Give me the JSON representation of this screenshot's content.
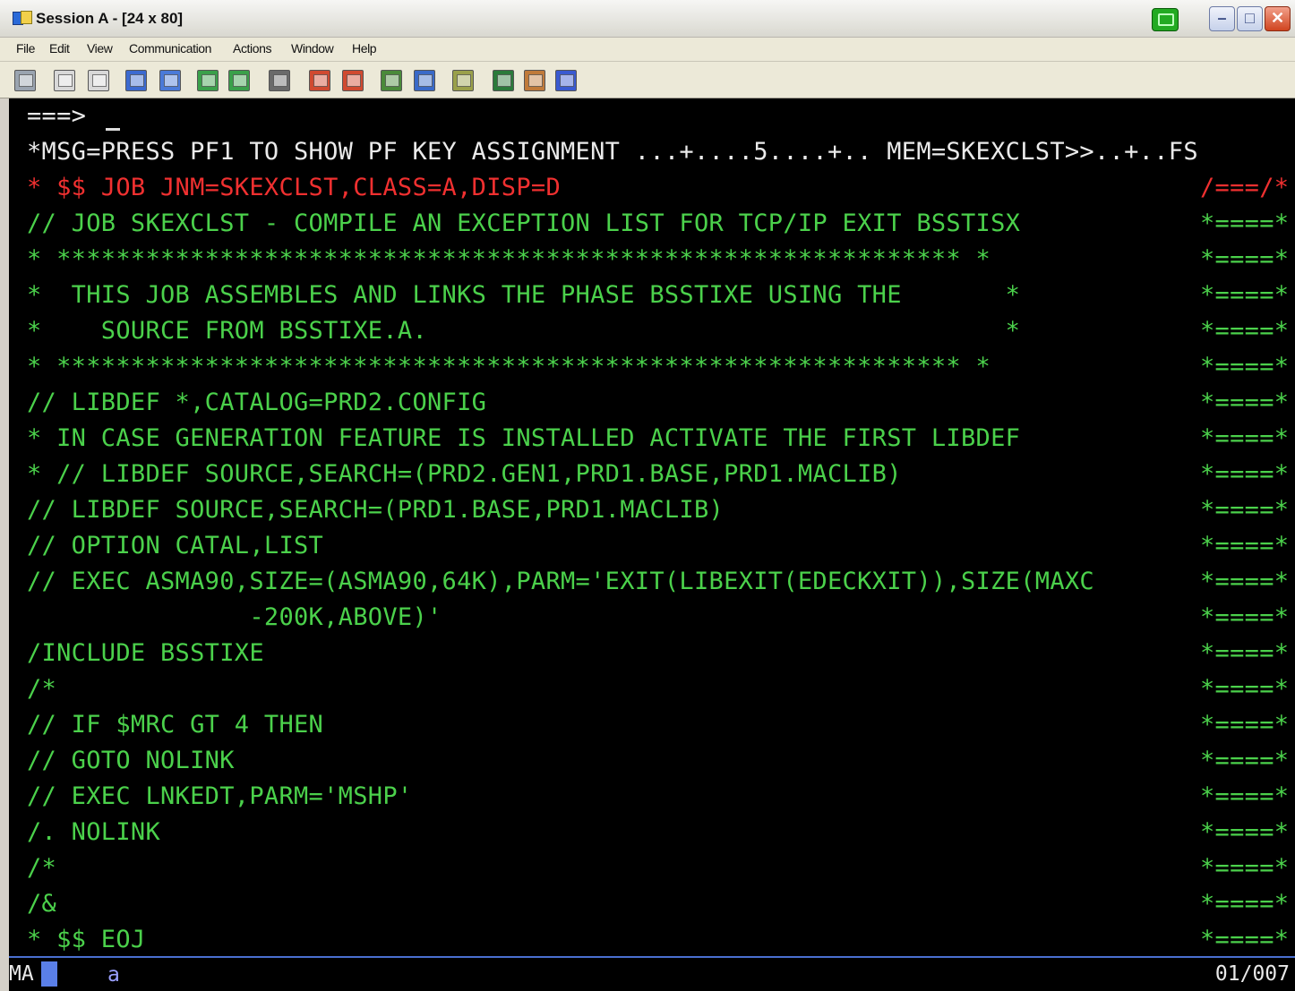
{
  "window": {
    "title": "Session A - [24 x 80]",
    "minimize_glyph": "–",
    "maximize_glyph": "□",
    "close_glyph": "✕"
  },
  "menu": [
    "File",
    "Edit",
    "View",
    "Communication",
    "Actions",
    "Window",
    "Help"
  ],
  "toolbar": {
    "icons": [
      "print-screen",
      "copy",
      "paste",
      "send",
      "receive",
      "display",
      "record",
      "macro",
      "play-macro",
      "stop-macro",
      "keypad-1",
      "keypad-2",
      "clipboard",
      "color",
      "edit-key",
      "monitor"
    ],
    "colors": [
      "#9aa4b0",
      "#d8d8d8",
      "#d8d8d8",
      "#3c6ad0",
      "#4a7ad8",
      "#3aa04a",
      "#3aa04a",
      "#6a6a6a",
      "#d04a30",
      "#d04a30",
      "#4a8a3a",
      "#3a6ac8",
      "#9aa04a",
      "#2a7a3a",
      "#c07a3a",
      "#3a5ad0"
    ]
  },
  "terminal": {
    "command_prompt": "===>",
    "lines": [
      {
        "text": "*MSG=PRESS PF1 TO SHOW PF KEY ASSIGNMENT ...+....5....+.. MEM=SKEXCLST>>..+..FS",
        "color": "white",
        "right": ""
      },
      {
        "text": "* $$ JOB JNM=SKEXCLST,CLASS=A,DISP=D",
        "color": "red",
        "right": "/===/*"
      },
      {
        "text": "// JOB SKEXCLST - COMPILE AN EXCEPTION LIST FOR TCP/IP EXIT BSSTISX",
        "color": "green",
        "right": "*====*"
      },
      {
        "text": "* ************************************************************* *",
        "color": "green",
        "right": "*====*"
      },
      {
        "text": "*  THIS JOB ASSEMBLES AND LINKS THE PHASE BSSTIXE USING THE       *",
        "color": "green",
        "right": "*====*"
      },
      {
        "text": "*    SOURCE FROM BSSTIXE.A.                                       *",
        "color": "green",
        "right": "*====*"
      },
      {
        "text": "* ************************************************************* *",
        "color": "green",
        "right": "*====*"
      },
      {
        "text": "// LIBDEF *,CATALOG=PRD2.CONFIG",
        "color": "green",
        "right": "*====*"
      },
      {
        "text": "* IN CASE GENERATION FEATURE IS INSTALLED ACTIVATE THE FIRST LIBDEF",
        "color": "green",
        "right": "*====*"
      },
      {
        "text": "* // LIBDEF SOURCE,SEARCH=(PRD2.GEN1,PRD1.BASE,PRD1.MACLIB)",
        "color": "green",
        "right": "*====*"
      },
      {
        "text": "// LIBDEF SOURCE,SEARCH=(PRD1.BASE,PRD1.MACLIB)",
        "color": "green",
        "right": "*====*"
      },
      {
        "text": "// OPTION CATAL,LIST",
        "color": "green",
        "right": "*====*"
      },
      {
        "text": "// EXEC ASMA90,SIZE=(ASMA90,64K),PARM='EXIT(LIBEXIT(EDECKXIT)),SIZE(MAXC",
        "color": "green",
        "right": "*====*"
      },
      {
        "text": "               -200K,ABOVE)'",
        "color": "green",
        "right": "*====*"
      },
      {
        "text": "/INCLUDE BSSTIXE",
        "color": "green",
        "right": "*====*"
      },
      {
        "text": "/*",
        "color": "green",
        "right": "*====*"
      },
      {
        "text": "// IF $MRC GT 4 THEN",
        "color": "green",
        "right": "*====*"
      },
      {
        "text": "// GOTO NOLINK",
        "color": "green",
        "right": "*====*"
      },
      {
        "text": "// EXEC LNKEDT,PARM='MSHP'",
        "color": "green",
        "right": "*====*"
      },
      {
        "text": "/. NOLINK",
        "color": "green",
        "right": "*====*"
      },
      {
        "text": "/*",
        "color": "green",
        "right": "*====*"
      },
      {
        "text": "/&",
        "color": "green",
        "right": "*====*"
      },
      {
        "text": "* $$ EOJ",
        "color": "green",
        "right": "*====*"
      }
    ]
  },
  "status": {
    "mode": "MA",
    "indicator": "a",
    "position": "01/007"
  }
}
